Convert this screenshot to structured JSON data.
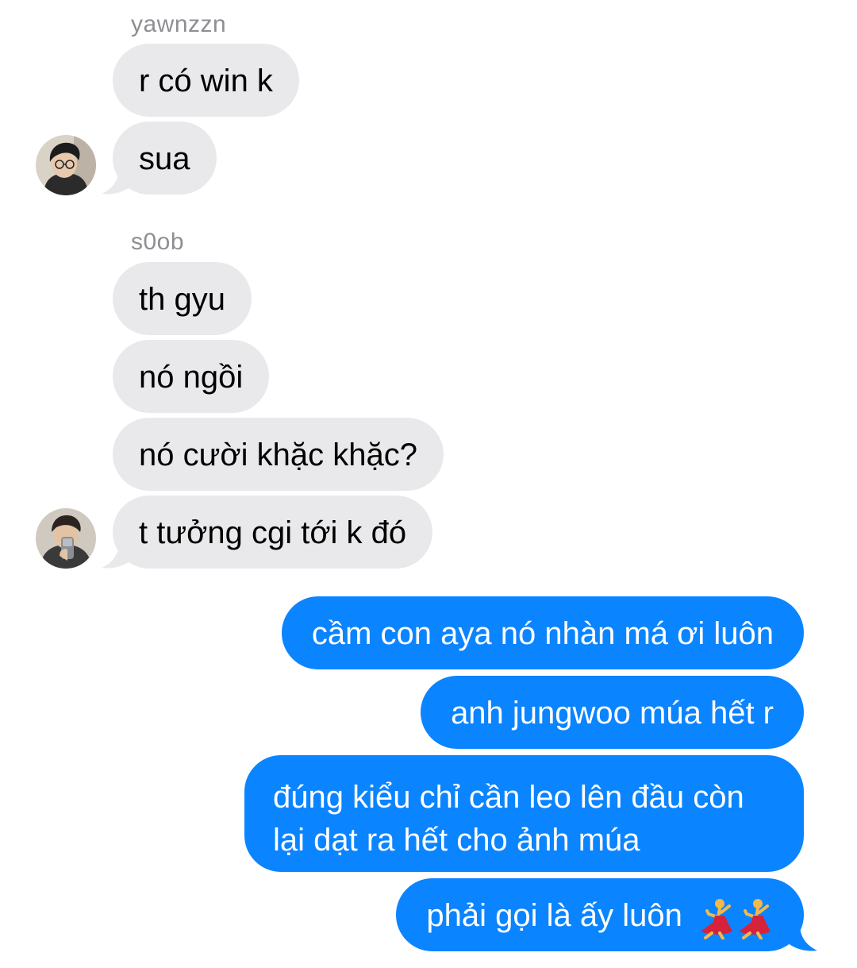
{
  "conversation": {
    "group1": {
      "sender": "yawnzzn",
      "messages": [
        "r có win k",
        "sua"
      ],
      "avatar_icon": "avatar-photo-glasses"
    },
    "group2": {
      "sender": "s0ob",
      "messages": [
        "th gyu",
        "nó ngồi",
        "nó cười khặc khặc?",
        "t tưởng cgi tới k đó"
      ],
      "avatar_icon": "avatar-photo-mirror-selfie"
    },
    "outgoing": {
      "messages": [
        "cầm con aya nó nhàn má ơi luôn",
        "anh jungwoo múa hết r",
        "đúng kiểu chỉ cần leo lên đầu còn lại dạt ra hết cho ảnh múa",
        "phải gọi là ấy luôn"
      ],
      "emoji": [
        "woman-dancing-emoji",
        "woman-dancing-emoji"
      ]
    }
  },
  "colors": {
    "incoming_bubble": "#e9e9eb",
    "outgoing_bubble": "#0b84ff",
    "sender_name": "#8e8e93",
    "background": "#ffffff"
  }
}
